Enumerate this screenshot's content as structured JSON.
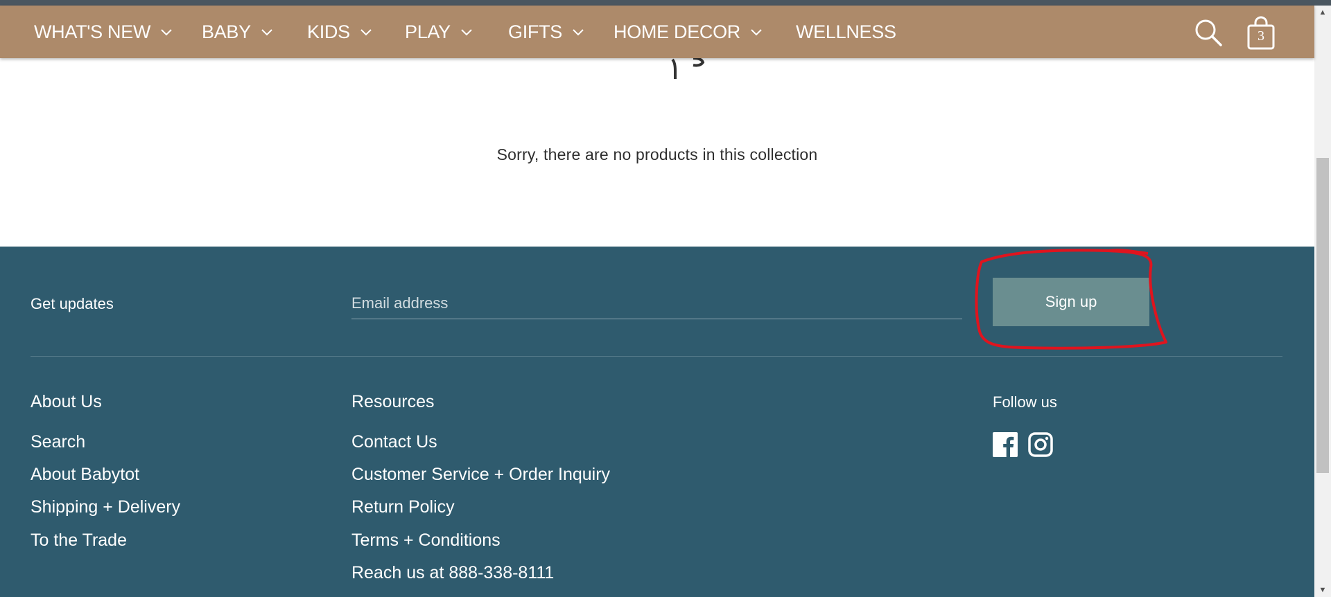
{
  "nav": {
    "items": [
      {
        "label": "WHAT'S NEW",
        "has_dropdown": true
      },
      {
        "label": "BABY",
        "has_dropdown": true
      },
      {
        "label": "KIDS",
        "has_dropdown": true
      },
      {
        "label": "PLAY",
        "has_dropdown": true
      },
      {
        "label": "GIFTS",
        "has_dropdown": true
      },
      {
        "label": "HOME DECOR",
        "has_dropdown": true
      },
      {
        "label": "WELLNESS",
        "has_dropdown": false
      }
    ],
    "search_icon": "search-icon",
    "cart_icon": "shopping-bag-icon",
    "cart_count": "3"
  },
  "collection": {
    "empty_message": "Sorry, there are no products in this collection"
  },
  "footer": {
    "newsletter": {
      "label": "Get updates",
      "email_placeholder": "Email address",
      "signup_label": "Sign up"
    },
    "about": {
      "heading": "About Us",
      "links": [
        "Search",
        "About Babytot",
        "Shipping + Delivery",
        "To the Trade"
      ]
    },
    "resources": {
      "heading": "Resources",
      "links": [
        "Contact Us",
        "Customer Service + Order Inquiry",
        "Return Policy",
        "Terms + Conditions",
        "Reach us at 888-338-8111"
      ]
    },
    "social": {
      "heading": "Follow us",
      "icons": [
        "facebook-icon",
        "instagram-icon"
      ]
    }
  },
  "colors": {
    "nav_background": "#ad8a6a",
    "footer_background": "#2f5b6e",
    "signup_button": "#6a8e90",
    "annotation_red": "#e0141e"
  }
}
